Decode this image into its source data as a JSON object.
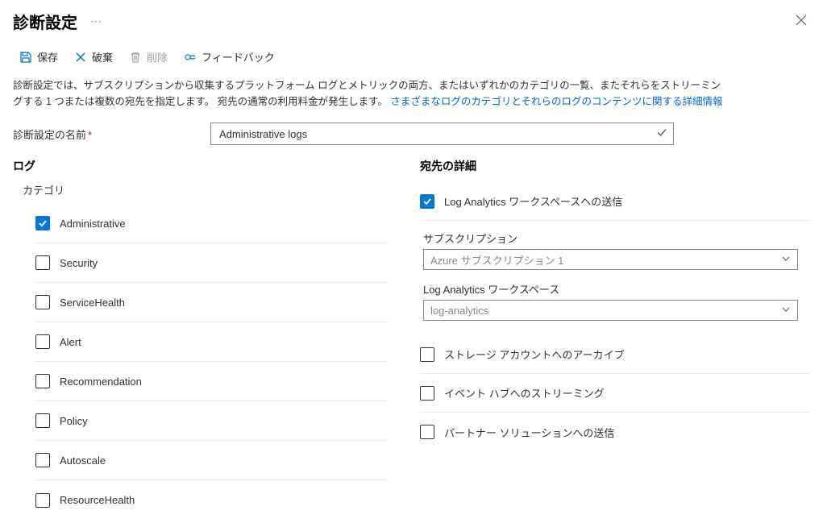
{
  "header": {
    "title": "診断設定",
    "close_label": "閉じる"
  },
  "toolbar": {
    "save": "保存",
    "discard": "破棄",
    "delete": "削除",
    "feedback": "フィードバック"
  },
  "description": {
    "text": "診断設定では、サブスクリプションから収集するプラットフォーム ログとメトリックの両方、またはいずれかのカテゴリの一覧、またそれらをストリーミングする 1 つまたは複数の宛先を指定します。 宛先の通常の利用料金が発生します。",
    "link": "さまざまなログのカテゴリとそれらのログのコンテンツに関する詳細情報"
  },
  "name_field": {
    "label": "診断設定の名前",
    "value": "Administrative logs"
  },
  "logs": {
    "heading": "ログ",
    "category_heading": "カテゴリ",
    "categories": [
      {
        "label": "Administrative",
        "checked": true
      },
      {
        "label": "Security",
        "checked": false
      },
      {
        "label": "ServiceHealth",
        "checked": false
      },
      {
        "label": "Alert",
        "checked": false
      },
      {
        "label": "Recommendation",
        "checked": false
      },
      {
        "label": "Policy",
        "checked": false
      },
      {
        "label": "Autoscale",
        "checked": false
      },
      {
        "label": "ResourceHealth",
        "checked": false
      }
    ]
  },
  "destination": {
    "heading": "宛先の詳細",
    "options": {
      "log_analytics": "Log Analytics ワークスペースへの送信",
      "storage": "ストレージ アカウントへのアーカイブ",
      "event_hub": "イベント ハブへのストリーミング",
      "partner": "パートナー ソリューションへの送信"
    },
    "subscription": {
      "label": "サブスクリプション",
      "value": "Azure サブスクリプション 1"
    },
    "workspace": {
      "label": "Log Analytics ワークスペース",
      "value": "log-analytics"
    }
  }
}
